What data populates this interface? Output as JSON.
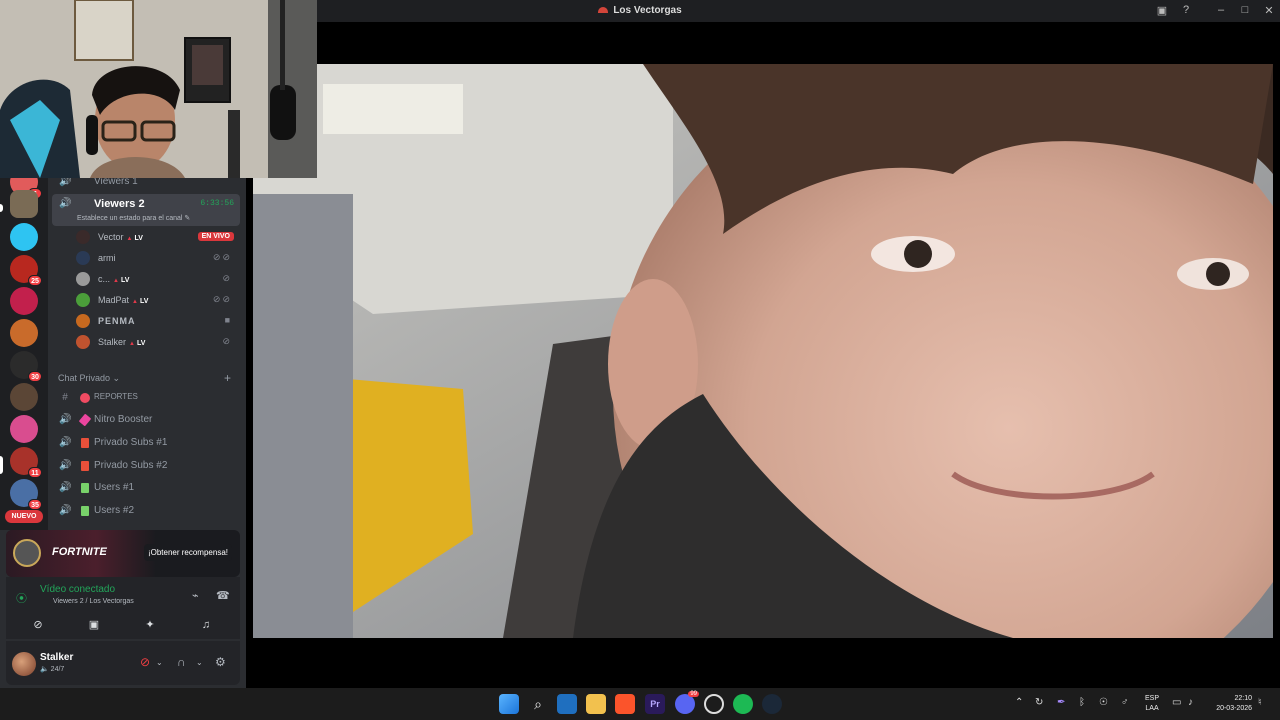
{
  "window": {
    "title": "Los Vectorgas"
  },
  "rail": {
    "badges": [
      "6",
      "25",
      "30",
      "11",
      "35"
    ],
    "nuevo_label": "NUEVO"
  },
  "channels": {
    "prev_channel": "Viewers 1",
    "active": {
      "name": "Viewers 2",
      "timer": "6:33:56",
      "status_hint": "Establece un estado para el canal"
    },
    "participants": [
      {
        "name": "Vector",
        "tag": "LV",
        "live_label": "EN VIVO"
      },
      {
        "name": "armi",
        "tag": ""
      },
      {
        "name": "c...",
        "tag": "LV"
      },
      {
        "name": "MadPat",
        "tag": "LV"
      },
      {
        "name": "PENMA",
        "tag": ""
      },
      {
        "name": "Stalker",
        "tag": "LV"
      }
    ],
    "category": "Chat Privado",
    "category_channels": [
      {
        "name": "REPORTES"
      },
      {
        "name": "Nitro Booster"
      },
      {
        "name": "Privado Subs #1"
      },
      {
        "name": "Privado Subs #2"
      },
      {
        "name": "Users #1"
      },
      {
        "name": "Users #2"
      }
    ]
  },
  "promo": {
    "game": "FORTNITE",
    "cta": "¡Obtener recompensa!"
  },
  "voice": {
    "status": "Vídeo conectado",
    "location": "Viewers 2 / Los Vectorgas"
  },
  "user": {
    "name": "Stalker",
    "status": "24/7"
  },
  "taskbar": {
    "discord_badge": "99",
    "lang_top": "ESP",
    "lang_bottom": "LAA",
    "time": "22:10",
    "date": "20-03-2026"
  },
  "colors": {
    "accent_green": "#23a55a",
    "live_red": "#da373c",
    "sidebar_bg": "#2b2d31",
    "rail_bg": "#1e1f22"
  }
}
